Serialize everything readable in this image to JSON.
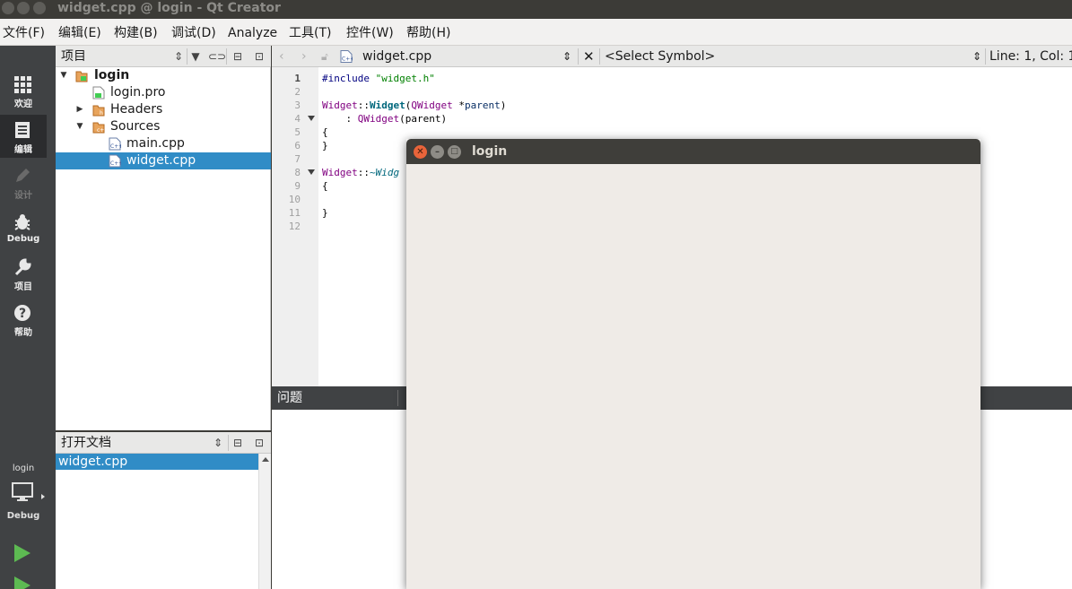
{
  "window": {
    "title": "widget.cpp @ login - Qt Creator"
  },
  "menubar": {
    "items": [
      "文件(F)",
      "编辑(E)",
      "构建(B)",
      "调试(D)",
      "Analyze",
      "工具(T)",
      "控件(W)",
      "帮助(H)"
    ]
  },
  "modebar": {
    "modes": [
      {
        "label": "欢迎",
        "icon": "grid-icon"
      },
      {
        "label": "编辑",
        "icon": "document-icon"
      },
      {
        "label": "设计",
        "icon": "pencil-icon"
      },
      {
        "label": "Debug",
        "icon": "bug-icon"
      },
      {
        "label": "项目",
        "icon": "wrench-icon"
      },
      {
        "label": "帮助",
        "icon": "help-icon"
      }
    ],
    "kit_project": "login",
    "kit_build": "Debug"
  },
  "projects": {
    "header": "项目",
    "tree": [
      {
        "label": "login",
        "icon": "project-folder-icon"
      },
      {
        "label": "login.pro",
        "icon": "pro-file-icon"
      },
      {
        "label": "Headers",
        "icon": "folder-icon"
      },
      {
        "label": "Sources",
        "icon": "folder-icon"
      },
      {
        "label": "main.cpp",
        "icon": "cpp-file-icon"
      },
      {
        "label": "widget.cpp",
        "icon": "cpp-file-icon"
      }
    ]
  },
  "open_docs": {
    "header": "打开文档",
    "items": [
      "widget.cpp"
    ]
  },
  "editor": {
    "file_name": "widget.cpp",
    "symbol": "<Select Symbol>",
    "position": "Line: 1, Col: 1",
    "line_numbers": [
      "1",
      "2",
      "3",
      "4",
      "5",
      "6",
      "7",
      "8",
      "9",
      "10",
      "11",
      "12"
    ],
    "lines": {
      "l1_pre": "#include ",
      "l1_str": "\"widget.h\"",
      "l3_cls": "Widget",
      "l3_sep": "::",
      "l3_fn": "Widget",
      "l3_rest_a": "(",
      "l3_cls2": "QWidget",
      "l3_rest_b": " *",
      "l3_param": "parent",
      "l3_rest_c": ")",
      "l4_pre": "    : ",
      "l4_cls": "QWidget",
      "l4_rest": "(parent)",
      "l5": "{",
      "l6": "}",
      "l8_cls": "Widget",
      "l8_sep": "::",
      "l8_fn": "~Widg",
      "l9": "{",
      "l11": "}"
    }
  },
  "output": {
    "header": "问题"
  },
  "app_window": {
    "title": "login"
  }
}
